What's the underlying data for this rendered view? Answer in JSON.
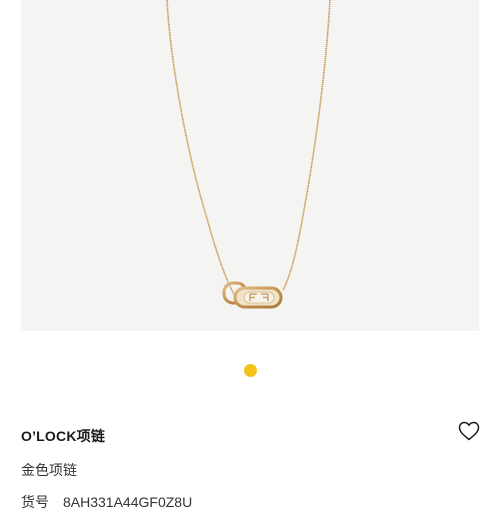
{
  "product": {
    "title": "O’LOCK项链",
    "subtitle": "金色项链",
    "sku_label": "货号",
    "sku_value": "8AH331A44GF0Z8U"
  },
  "carousel": {
    "dot_count": 1,
    "active_index": 0,
    "active_color": "#f4c31a"
  },
  "icons": {
    "favorite": "heart-outline-icon"
  },
  "colors": {
    "image_bg": "#f4f4f2",
    "gold": "#c99a55"
  }
}
